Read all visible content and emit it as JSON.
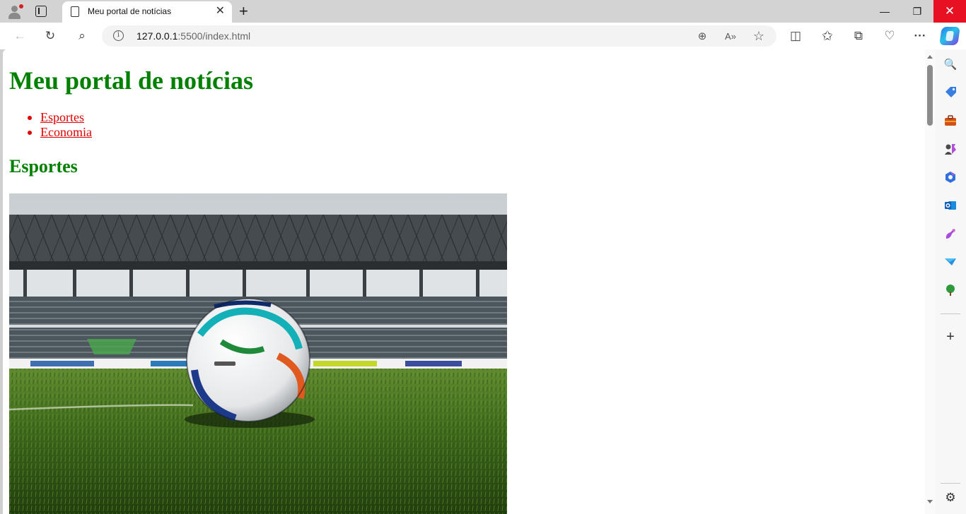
{
  "browser": {
    "tab": {
      "title": "Meu portal de notícias",
      "close": "✕"
    },
    "new_tab": "+",
    "window": {
      "minimize": "—",
      "maximize": "❐",
      "close": "✕"
    },
    "address": {
      "host": "127.0.0.1",
      "rest": ":5500/index.html"
    },
    "nav": {
      "back": "←",
      "reload": "↻",
      "search": "⌕",
      "info": "i"
    },
    "address_actions": {
      "zoom": "⊕",
      "read_aloud": "A»",
      "favorite": "☆"
    },
    "toolbar_icons": {
      "split": "◫",
      "favorites": "✩",
      "collections": "⧉",
      "health": "♡",
      "more": "···"
    }
  },
  "page": {
    "heading": "Meu portal de notícias",
    "nav": [
      {
        "label": "Esportes"
      },
      {
        "label": "Economia"
      }
    ],
    "section_title": "Esportes"
  },
  "sidebar": {
    "icons": [
      "search-icon",
      "tag-icon",
      "toolbox-icon",
      "games-icon",
      "microsoft365-icon",
      "outlook-icon",
      "designer-icon",
      "drop-icon",
      "tree-icon",
      "add-icon",
      "settings-icon"
    ],
    "labels": {
      "search": "🔍",
      "add": "+",
      "settings": "⚙"
    }
  },
  "colors": {
    "heading": "#008000",
    "link": "#e00000",
    "close_button": "#e81123"
  }
}
